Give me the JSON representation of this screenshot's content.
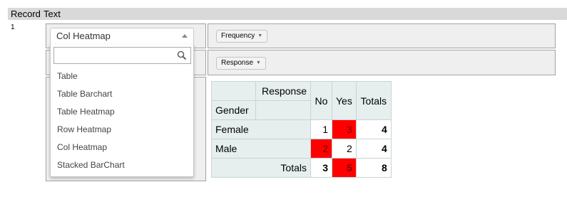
{
  "header": {
    "col_record": "Record",
    "col_text": "Text"
  },
  "row_number": "1",
  "renderer_dropdown": {
    "selected": "Col Heatmap",
    "search_value": "",
    "options": [
      "Table",
      "Table Barchart",
      "Table Heatmap",
      "Row Heatmap",
      "Col Heatmap",
      "Stacked BarChart"
    ]
  },
  "pivot": {
    "aggregator_label": "Frequency",
    "col_attr_label": "Response",
    "row_attr_header": "Gender",
    "col_attr_header": "Response",
    "columns": [
      "No",
      "Yes"
    ],
    "totals_col_label": "Totals",
    "rows": [
      {
        "label": "Female",
        "values": [
          "1",
          "3"
        ],
        "total": "4"
      },
      {
        "label": "Male",
        "values": [
          "2",
          "2"
        ],
        "total": "4"
      }
    ],
    "totals_row_label": "Totals",
    "totals_row": [
      "3",
      "5"
    ],
    "grand_total": "8",
    "heat_color": "#ff0000"
  }
}
